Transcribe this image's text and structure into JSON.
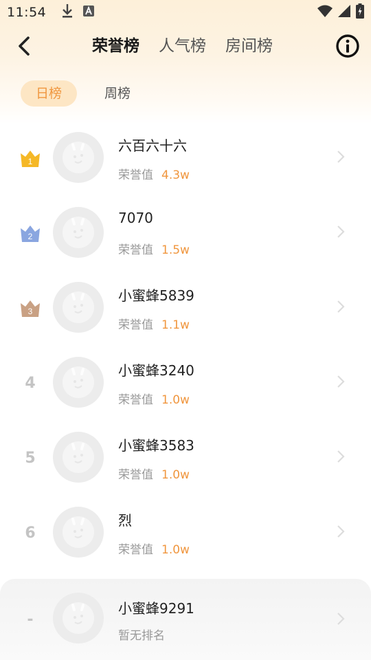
{
  "status_bar": {
    "time": "11:54",
    "icons": [
      "download-icon",
      "a-icon",
      "wifi-icon",
      "signal-icon",
      "battery-icon"
    ]
  },
  "header": {
    "tabs": [
      {
        "label": "荣誉榜",
        "active": true
      },
      {
        "label": "人气榜",
        "active": false
      },
      {
        "label": "房间榜",
        "active": false
      }
    ]
  },
  "subtabs": [
    {
      "label": "日榜",
      "active": true
    },
    {
      "label": "周榜",
      "active": false
    }
  ],
  "value_label": "荣誉值",
  "ranking": [
    {
      "rank": "1",
      "badge": "gold",
      "name": "六百六十六",
      "value": "4.3w"
    },
    {
      "rank": "2",
      "badge": "silver",
      "name": "7070",
      "value": "1.5w"
    },
    {
      "rank": "3",
      "badge": "bronze",
      "name": "小蜜蜂5839",
      "value": "1.1w"
    },
    {
      "rank": "4",
      "badge": "",
      "name": "小蜜蜂3240",
      "value": "1.0w"
    },
    {
      "rank": "5",
      "badge": "",
      "name": "小蜜蜂3583",
      "value": "1.0w"
    },
    {
      "rank": "6",
      "badge": "",
      "name": "烈",
      "value": "1.0w"
    }
  ],
  "my_rank": {
    "rank": "-",
    "name": "小蜜蜂9291",
    "status": "暂无排名"
  },
  "colors": {
    "accent": "#f0963e",
    "gold": "#f5b826",
    "silver": "#8aa6e0",
    "bronze": "#c9a184"
  }
}
